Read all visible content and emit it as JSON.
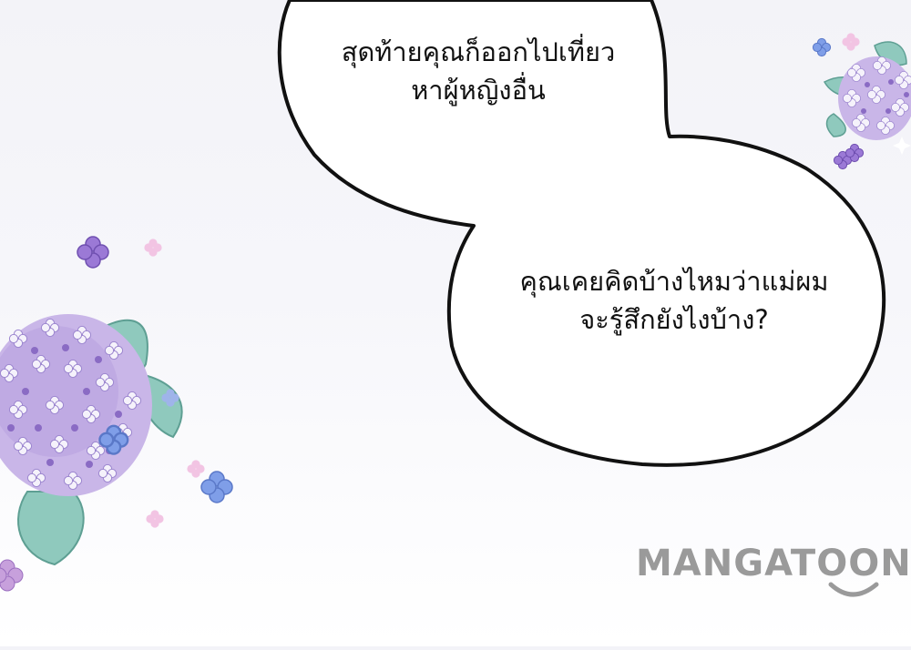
{
  "speech_bubbles": [
    {
      "lines": [
        "สุดท้ายคุณก็ออกไปเที่ยว",
        "หาผู้หญิงอื่น"
      ]
    },
    {
      "lines": [
        "คุณเคยคิดบ้างไหมว่าแม่ผม",
        "จะรู้สึกยังไงบ้าง?"
      ]
    }
  ],
  "watermark": {
    "text": "MANGATOON"
  },
  "icons": [
    "hydrangea-flower-icon",
    "leaf-icon",
    "sparkle-icon"
  ],
  "colors": {
    "bubble_fill": "#ffffff",
    "bubble_outline": "#111111",
    "hydrangea_lilac": "#c9b6e8",
    "hydrangea_purple": "#8a6bc4",
    "hydrangea_blue": "#7f9ee8",
    "leaf": "#8fc9bd",
    "watermark": "#9a9a9a"
  }
}
